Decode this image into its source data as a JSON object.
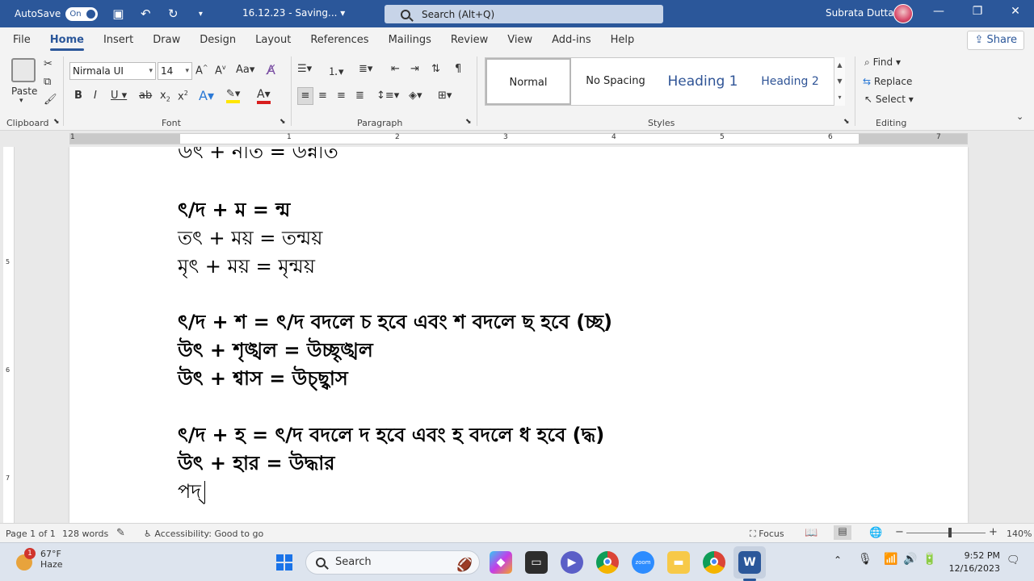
{
  "titlebar": {
    "autosave_label": "AutoSave",
    "autosave_state": "On",
    "doc_title": "16.12.23 - Saving...",
    "search_placeholder": "Search (Alt+Q)",
    "user_name": "Subrata Dutta"
  },
  "menu": {
    "tabs": [
      "File",
      "Home",
      "Insert",
      "Draw",
      "Design",
      "Layout",
      "References",
      "Mailings",
      "Review",
      "View",
      "Add-ins",
      "Help"
    ],
    "active_tab": "Home",
    "share_label": "Share"
  },
  "ribbon": {
    "clipboard": {
      "paste_label": "Paste",
      "group_label": "Clipboard"
    },
    "font": {
      "font_name": "Nirmala UI",
      "font_size": "14",
      "group_label": "Font"
    },
    "paragraph": {
      "group_label": "Paragraph"
    },
    "styles": {
      "items": [
        "Normal",
        "No Spacing",
        "Heading 1",
        "Heading 2"
      ],
      "group_label": "Styles"
    },
    "editing": {
      "find_label": "Find",
      "replace_label": "Replace",
      "select_label": "Select",
      "group_label": "Editing"
    }
  },
  "ruler": {
    "numbers": [
      "1",
      "1",
      "2",
      "3",
      "4",
      "5",
      "6",
      "7"
    ]
  },
  "document": {
    "lines": [
      "উৎ + নতি = উন্নতি",
      "ৎ/দ + ম = ন্ম",
      "তৎ + ময় = তন্ময়",
      "মৃৎ + ময় = মৃন্ময়",
      "ৎ/দ + শ = ৎ/দ বদলে চ হবে এবং শ বদলে ছ হবে (চ্ছ)",
      "উৎ + শৃঙ্খল = উচ্ছৃঙ্খল",
      "উৎ + শ্বাস = উচ্ছ্বাস",
      "ৎ/দ + হ = ৎ/দ বদলে দ হবে এবং হ বদলে ধ হবে (দ্ধ)",
      "উৎ + হার = উদ্ধার",
      "পদ্"
    ]
  },
  "statusbar": {
    "page": "Page 1 of 1",
    "words": "128 words",
    "accessibility": "Accessibility: Good to go",
    "focus": "Focus",
    "zoom": "140%"
  },
  "taskbar": {
    "weather_temp": "67°F",
    "weather_desc": "Haze",
    "weather_badge": "1",
    "search_label": "Search",
    "time": "9:52 PM",
    "date": "12/16/2023"
  },
  "colors": {
    "word_blue": "#2b579a",
    "heading_blue": "#2f5496"
  }
}
